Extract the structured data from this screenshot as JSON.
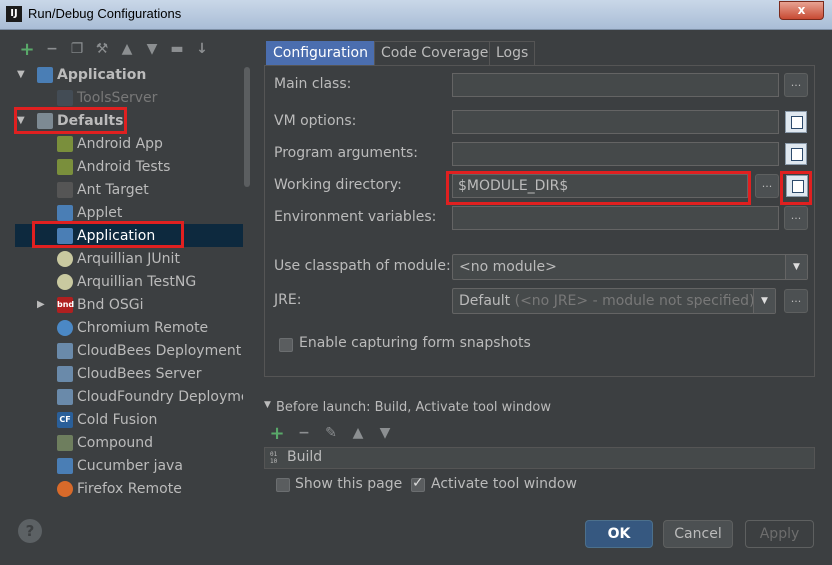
{
  "window": {
    "app_icon": "IJ",
    "title": "Run/Debug Configurations",
    "close_label": "x"
  },
  "toolbar": {
    "icons": [
      "add-icon",
      "remove-icon",
      "copy-icon",
      "edit-defaults-icon",
      "move-up-icon",
      "move-down-icon",
      "folder-icon",
      "sort-icon"
    ]
  },
  "tree": {
    "items": [
      {
        "label": "Application",
        "level": 0,
        "expanded": true,
        "bold": true,
        "icon": "application-icon"
      },
      {
        "label": "ToolsServer",
        "level": 1,
        "dim": true,
        "icon": "application-icon"
      },
      {
        "label": "Defaults",
        "level": 0,
        "expanded": true,
        "bold": true,
        "icon": "wrench-icon"
      },
      {
        "label": "Android App",
        "level": 1,
        "icon": "android-folder-icon"
      },
      {
        "label": "Android Tests",
        "level": 1,
        "icon": "android-folder-icon"
      },
      {
        "label": "Ant Target",
        "level": 1,
        "icon": "ant-icon"
      },
      {
        "label": "Applet",
        "level": 1,
        "icon": "applet-icon"
      },
      {
        "label": "Application",
        "level": 1,
        "selected": true,
        "icon": "application-icon"
      },
      {
        "label": "Arquillian JUnit",
        "level": 1,
        "icon": "arquillian-icon"
      },
      {
        "label": "Arquillian TestNG",
        "level": 1,
        "icon": "arquillian-icon"
      },
      {
        "label": "Bnd OSGi",
        "level": 1,
        "collapsed": true,
        "icon": "bnd-icon"
      },
      {
        "label": "Chromium Remote",
        "level": 1,
        "icon": "chromium-icon"
      },
      {
        "label": "CloudBees Deployment",
        "level": 1,
        "icon": "cloud-icon"
      },
      {
        "label": "CloudBees Server",
        "level": 1,
        "icon": "cloud-icon"
      },
      {
        "label": "CloudFoundry Deploymen",
        "level": 1,
        "icon": "cloud-icon"
      },
      {
        "label": "Cold Fusion",
        "level": 1,
        "icon": "coldfusion-icon"
      },
      {
        "label": "Compound",
        "level": 1,
        "icon": "folder-icon"
      },
      {
        "label": "Cucumber java",
        "level": 1,
        "icon": "cucumber-icon"
      },
      {
        "label": "Firefox Remote",
        "level": 1,
        "icon": "firefox-icon"
      }
    ]
  },
  "tabs": [
    {
      "label": "Configuration",
      "active": true
    },
    {
      "label": "Code Coverage"
    },
    {
      "label": "Logs"
    }
  ],
  "form": {
    "main_class_label": "Main class:",
    "main_class_value": "",
    "vm_options_label": "VM options:",
    "vm_options_value": "",
    "program_args_label": "Program arguments:",
    "program_args_value": "",
    "working_dir_label": "Working directory:",
    "working_dir_value": "$MODULE_DIR$",
    "env_vars_label": "Environment variables:",
    "env_vars_value": "",
    "classpath_label": "Use classpath of module:",
    "classpath_value": "<no module>",
    "jre_label": "JRE:",
    "jre_value": "Default",
    "jre_sub": "(<no JRE> - module not specified)",
    "snapshots_label": "Enable capturing form snapshots",
    "snapshots_checked": false,
    "browse_label": "..."
  },
  "before_launch": {
    "header": "Before launch: Build, Activate tool window",
    "build_label": "Build",
    "build_icon_text": "0 1\n1 0",
    "show_page_label": "Show this page",
    "show_page_checked": false,
    "activate_label": "Activate tool window",
    "activate_checked": true
  },
  "buttons": {
    "help": "?",
    "ok": "OK",
    "cancel": "Cancel",
    "apply": "Apply"
  },
  "colors": {
    "background": "#3c3f41",
    "selection": "#0d293e",
    "accent_tab": "#4b6eaf",
    "highlight_box": "#e02020",
    "ok_button": "#365880"
  }
}
